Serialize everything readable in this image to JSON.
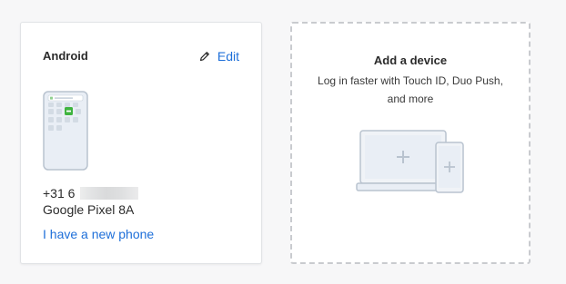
{
  "device_card": {
    "name": "Android",
    "edit_label": "Edit",
    "phone_number_prefix": "+31 6",
    "model": "Google Pixel 8A",
    "new_phone_link": "I have a new phone"
  },
  "add_device_card": {
    "title": "Add a device",
    "description": "Log in faster with Touch ID, Duo Push, and more"
  },
  "icons": {
    "edit": "pencil-icon",
    "phone": "android-phone-illustration",
    "add_device": "laptop-phone-plus-illustration"
  },
  "colors": {
    "link": "#1e6fd9",
    "background": "#f7f7f8",
    "card": "#ffffff",
    "illustration_fill": "#e9eef5",
    "illustration_stroke": "#b9c3cf",
    "app_badge": "#3fb43f"
  }
}
